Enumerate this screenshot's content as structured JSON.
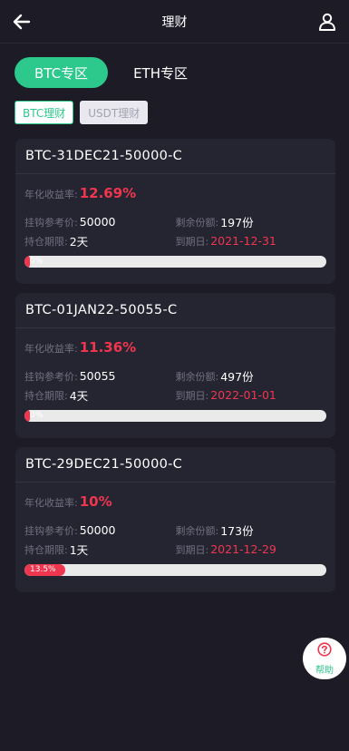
{
  "header": {
    "title": "理财",
    "back_icon": "back-arrow-icon",
    "user_icon": "user-icon"
  },
  "zones": [
    {
      "label": "BTC专区",
      "active": true
    },
    {
      "label": "ETH专区",
      "active": false
    }
  ],
  "subtabs": [
    {
      "label": "BTC理财",
      "active": true
    },
    {
      "label": "USDT理财",
      "active": false
    }
  ],
  "labels": {
    "yield": "年化收益率:",
    "ref_price": "挂钩参考价:",
    "remaining": "剩余份额:",
    "period": "持仓期限:",
    "expiry": "到期日:"
  },
  "products": [
    {
      "name": "BTC-31DEC21-50000-C",
      "yield": "12.69%",
      "ref_price": "50000",
      "remaining": "197份",
      "period": "2天",
      "expiry": "2021-12-31",
      "progress_text": "0%",
      "progress_fraction": 0.01
    },
    {
      "name": "BTC-01JAN22-50055-C",
      "yield": "11.36%",
      "ref_price": "50055",
      "remaining": "497份",
      "period": "4天",
      "expiry": "2022-01-01",
      "progress_text": "0%",
      "progress_fraction": 0.006
    },
    {
      "name": "BTC-29DEC21-50000-C",
      "yield": "10%",
      "ref_price": "50000",
      "remaining": "173份",
      "period": "1天",
      "expiry": "2021-12-29",
      "progress_text": "13.5%",
      "progress_fraction": 0.135
    }
  ],
  "help": {
    "label": "帮助",
    "icon": "question-circle-icon"
  },
  "colors": {
    "accent": "#2cc88c",
    "red": "#f0364f",
    "background": "#1d1c26",
    "card": "#252532"
  }
}
